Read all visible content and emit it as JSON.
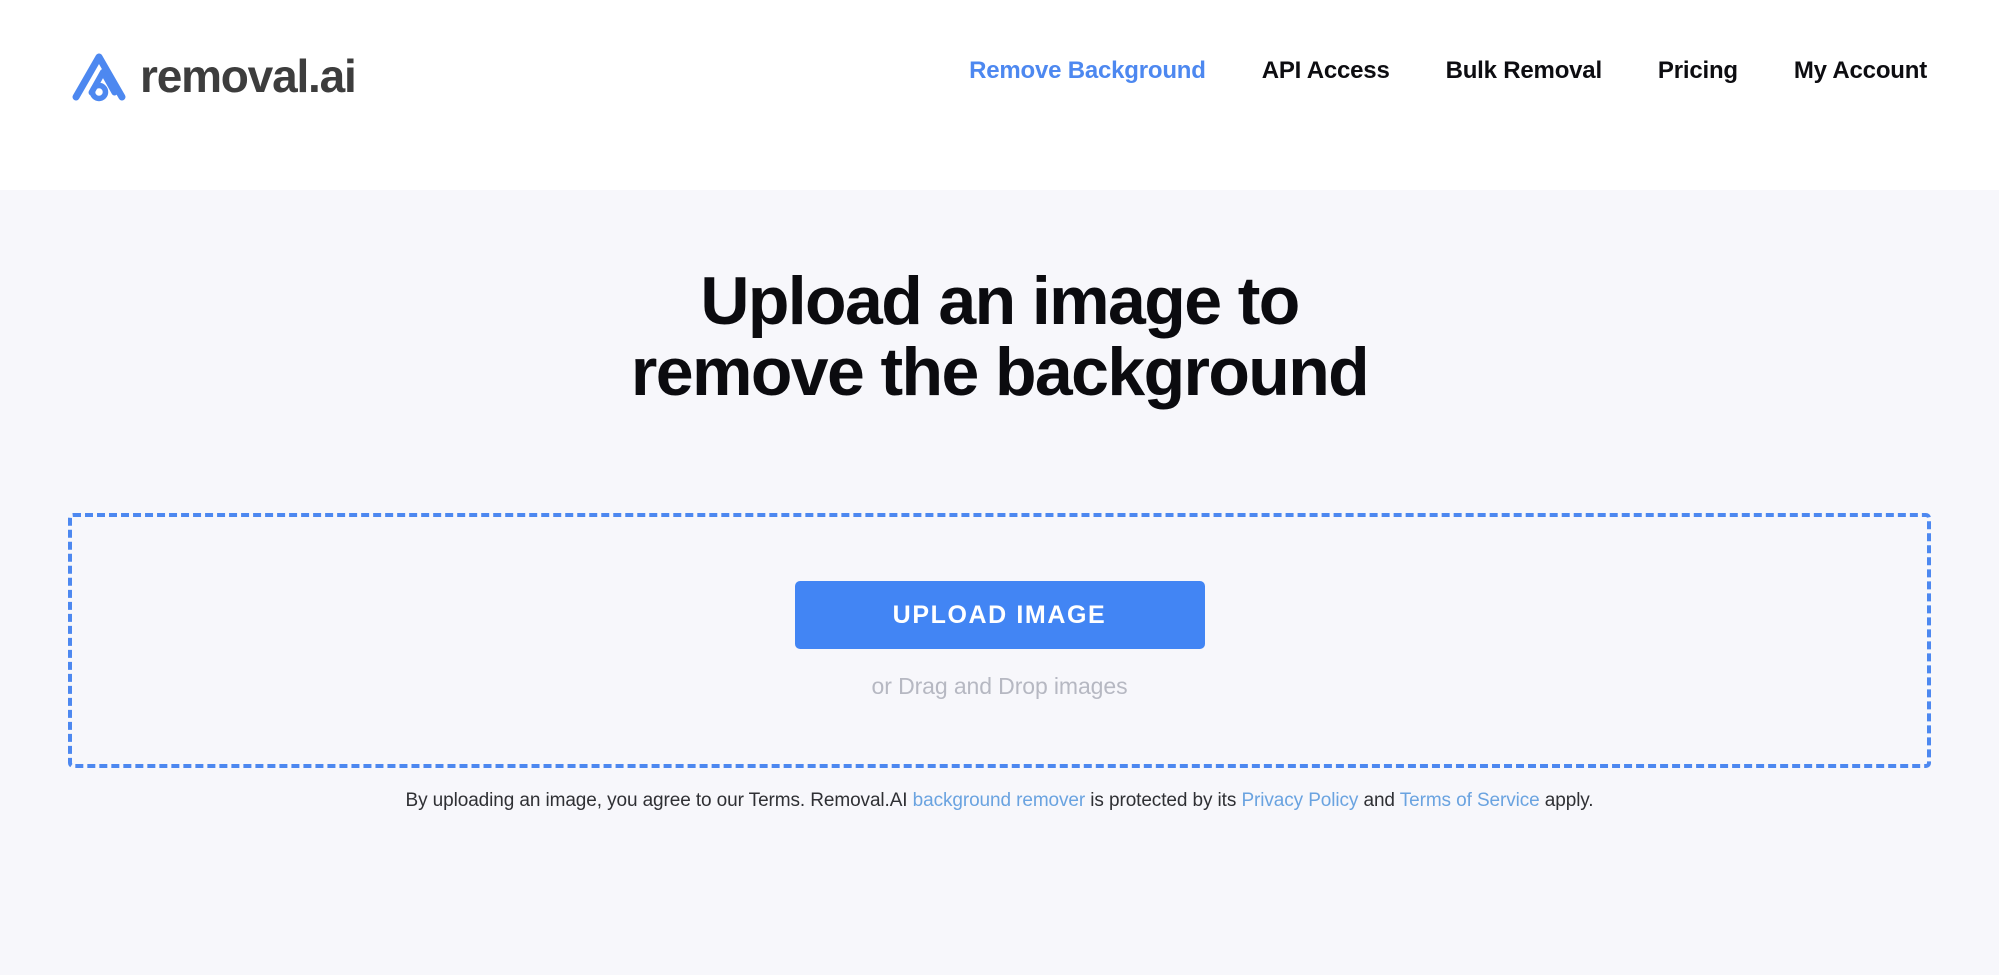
{
  "brand": {
    "name": "removal.ai",
    "mark_icon": "removal-ai-triangle-logo-icon",
    "mark_color": "#4d88f0",
    "wordmark_color": "#3d3d3d"
  },
  "nav": {
    "items": [
      {
        "label": "Remove Background",
        "active": true
      },
      {
        "label": "API Access",
        "active": false
      },
      {
        "label": "Bulk Removal",
        "active": false
      },
      {
        "label": "Pricing",
        "active": false
      },
      {
        "label": "My Account",
        "active": false
      }
    ],
    "active_color": "#4d88f0",
    "inactive_color": "#0d0d11"
  },
  "hero": {
    "title_line_1": "Upload an image to",
    "title_line_2": "remove the background"
  },
  "dropzone": {
    "upload_button_label": "UPLOAD IMAGE",
    "hint": "or Drag and Drop images",
    "border_color": "#4d88f0",
    "button_color": "#4285f4"
  },
  "disclaimer": {
    "part_1": "By uploading an image, you agree to our Terms. Removal.AI ",
    "link_1": "background remover",
    "part_2": " is protected by its ",
    "link_2": "Privacy Policy",
    "part_3": " and ",
    "link_3": "Terms of Service",
    "part_4": " apply.",
    "link_color": "#6aa3e0"
  }
}
